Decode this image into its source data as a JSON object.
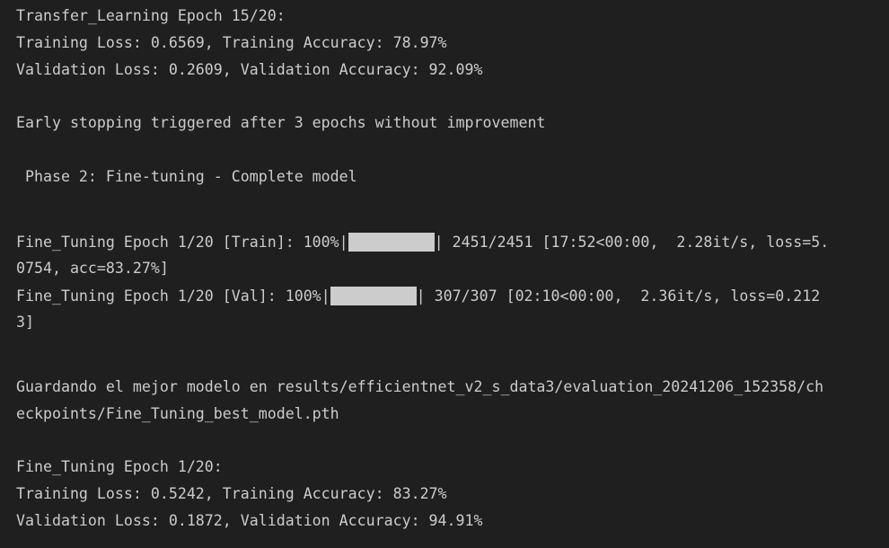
{
  "colors": {
    "background": "#1f1f1f",
    "text": "#cccccc",
    "progress_fill": "#cccccc"
  },
  "output": {
    "tl_epoch_header": "Transfer_Learning Epoch 15/20:",
    "tl_train_metrics": "Training Loss: 0.6569, Training Accuracy: 78.97%",
    "tl_val_metrics": "Validation Loss: 0.2609, Validation Accuracy: 92.09%",
    "early_stopping": "Early stopping triggered after 3 epochs without improvement",
    "phase2_header": " Phase 2: Fine-tuning - Complete model",
    "ft_train_progress": {
      "prefix": "Fine_Tuning Epoch 1/20 [Train]: 100%|",
      "fill": 1.0,
      "suffix": "| 2451/2451 [17:52<00:00,  2.28it/s, loss=5.",
      "wrap": "0754, acc=83.27%]"
    },
    "ft_val_progress": {
      "prefix": "Fine_Tuning Epoch 1/20 [Val]: 100%|",
      "fill": 1.0,
      "suffix": "| 307/307 [02:10<00:00,  2.36it/s, loss=0.212",
      "wrap": "3]"
    },
    "save_line_1": "Guardando el mejor modelo en results/efficientnet_v2_s_data3/evaluation_20241206_152358/ch",
    "save_line_2": "eckpoints/Fine_Tuning_best_model.pth",
    "ft_epoch_header": "Fine_Tuning Epoch 1/20:",
    "ft_train_metrics": "Training Loss: 0.5242, Training Accuracy: 83.27%",
    "ft_val_metrics": "Validation Loss: 0.1872, Validation Accuracy: 94.91%"
  }
}
